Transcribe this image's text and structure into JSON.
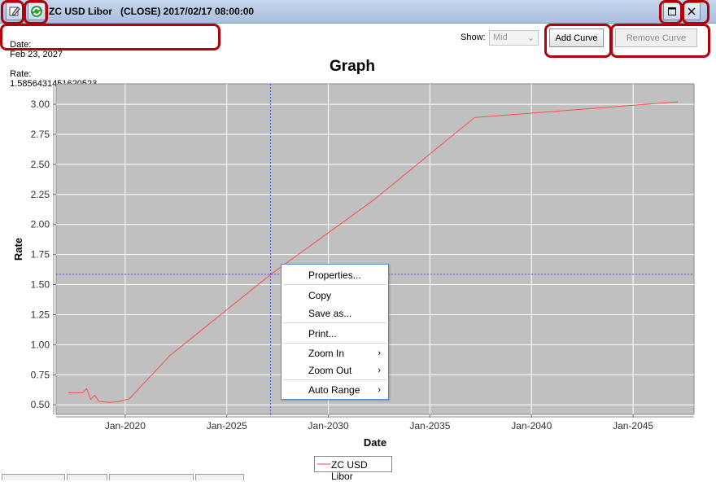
{
  "window": {
    "title": "ZC USD Libor   (CLOSE) 2017/02/17 08:00:00",
    "edit_icon": "edit-icon",
    "refresh_icon": "refresh-icon",
    "maximize_icon": "maximize-icon",
    "close_icon": "close-icon"
  },
  "info": {
    "date_label": "Date:",
    "date_value": "Feb 23, 2027",
    "rate_label": "Rate:",
    "rate_value": "1.5856431451620523"
  },
  "controls": {
    "show_label": "Show:",
    "show_value": "Mid",
    "add_curve": "Add Curve",
    "remove_curve": "Remove Curve"
  },
  "context_menu": {
    "items": [
      "Properties...",
      "Copy",
      "Save as...",
      "Print...",
      "Zoom In",
      "Zoom Out",
      "Auto Range"
    ]
  },
  "colors": {
    "highlight": "#b0000b",
    "series": "#ff4a4a",
    "plot_bg": "#c0c0c0",
    "crosshair": "#3c3cd0"
  },
  "chart_data": {
    "type": "line",
    "title": "Graph",
    "xlabel": "Date",
    "ylabel": "Rate",
    "x_ticks": [
      "Jan-2020",
      "Jan-2025",
      "Jan-2030",
      "Jan-2035",
      "Jan-2040",
      "Jan-2045"
    ],
    "y_ticks": [
      "0.50",
      "0.75",
      "1.00",
      "1.25",
      "1.50",
      "1.75",
      "2.00",
      "2.25",
      "2.50",
      "2.75",
      "3.00"
    ],
    "xlim": [
      2016.6,
      2048.0
    ],
    "ylim": [
      0.42,
      3.17
    ],
    "grid": true,
    "legend": "bottom-center",
    "crosshair": {
      "x": 2027.15,
      "y": 1.5856
    },
    "series": [
      {
        "name": "ZC USD Libor",
        "x": [
          2017.2,
          2017.6,
          2017.9,
          2018.1,
          2018.3,
          2018.5,
          2018.7,
          2018.9,
          2019.2,
          2019.6,
          2020.2,
          2022.2,
          2027.2,
          2032.2,
          2037.2,
          2047.2
        ],
        "y": [
          0.6,
          0.6,
          0.6,
          0.635,
          0.545,
          0.58,
          0.53,
          0.525,
          0.52,
          0.525,
          0.55,
          0.91,
          1.59,
          2.2,
          2.89,
          3.02
        ]
      }
    ]
  }
}
